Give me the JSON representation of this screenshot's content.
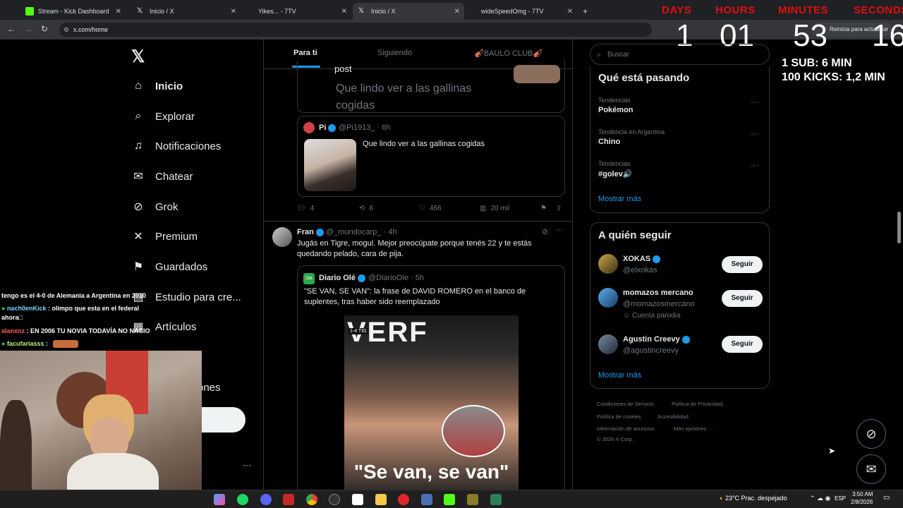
{
  "tabs": [
    {
      "title": "Stream - Kick Dashboard",
      "color": "#53fc18"
    },
    {
      "title": "Inicio / X",
      "color": "#000000"
    },
    {
      "title": "Yikes... - 7TV",
      "color": "#29b6f6"
    },
    {
      "title": "Inicio / X",
      "color": "#000000"
    },
    {
      "title": "wideSpeedOmg - 7TV",
      "color": "#29b6f6"
    }
  ],
  "browser": {
    "url": "x.com/home",
    "restart_label": "Reinicia para actualizar"
  },
  "countdown": {
    "labels": [
      "DAYS",
      "HOURS",
      "MINUTES",
      "SECONDS"
    ],
    "values": [
      "1",
      "01",
      "53",
      "16"
    ]
  },
  "subathon": {
    "line1": "1 SUB: 6 MIN",
    "line2": "100 KICKS: 1,2 MIN"
  },
  "nav": [
    {
      "label": "Inicio",
      "icon": "home-icon"
    },
    {
      "label": "Explorar",
      "icon": "search-icon"
    },
    {
      "label": "Notificaciones",
      "icon": "bell-icon"
    },
    {
      "label": "Chatear",
      "icon": "mail-icon"
    },
    {
      "label": "Grok",
      "icon": "grok-icon"
    },
    {
      "label": "Premium",
      "icon": "x-logo-icon"
    },
    {
      "label": "Guardados",
      "icon": "bookmark-icon"
    },
    {
      "label": "Estudio para cre...",
      "icon": "studio-icon"
    },
    {
      "label": "Artículos",
      "icon": "article-icon"
    },
    {
      "label": "ones",
      "icon": ""
    }
  ],
  "feed_tabs": [
    "Para ti",
    "Siguiendo",
    "🎻BAULO CLUB🎻"
  ],
  "post1": {
    "quoted_tail": "post",
    "quoted_text": "Que lindo ver a las gallinas cogidas",
    "inner_name": "Pi",
    "inner_handle": "@Pi1913_ · 6h",
    "inner_text": "Que lindo ver a las gallinas cogidas",
    "replies": "4",
    "reposts": "6",
    "likes": "466",
    "views": "20 mil"
  },
  "post2": {
    "name": "Fran",
    "handle": "@_mundocarp_ · 4h",
    "text": "Jugás en Tigre, mogul. Mejor preocúpate porque tenés 22 y te estás quedando pelado, cara de pija.",
    "quoted_name": "Diario Olé",
    "quoted_handle": "@DiarioOle · 5h",
    "quoted_text": "\"SE VAN, SE VAN\": la frase de DAVID ROMERO en el banco de suplentes, tras haber sido reemplazado",
    "image_caption": "\"Se van, se van\"",
    "image_score": "1-4  TIG"
  },
  "search_placeholder": "Buscar",
  "trends": {
    "title": "Qué está pasando",
    "items": [
      {
        "category": "Tendencias",
        "name": "Pokémon"
      },
      {
        "category": "Tendencia en Argentina",
        "name": "Chino"
      },
      {
        "category": "Tendencias",
        "name": "#golev🔊"
      }
    ],
    "more": "Mostrar más"
  },
  "follow": {
    "title": "A quién seguir",
    "items": [
      {
        "name": "XOKAS",
        "handle": "@elxokas",
        "extra": ""
      },
      {
        "name": "momazos mercano",
        "handle": "@momazosmercano",
        "extra": "Cuenta parodia"
      },
      {
        "name": "Agustin Creevy",
        "handle": "@agustincreevy",
        "extra": ""
      }
    ],
    "button": "Seguir",
    "more": "Mostrar más"
  },
  "footer": {
    "l1": "Condiciones de Servicio",
    "l2": "Política de Privacidad",
    "l3": "Política de cookies",
    "l4": "Accesibilidad",
    "l5": "Información de anuncios",
    "l6": "Más opciones ···",
    "l7": "© 2026 X Corp."
  },
  "chat": [
    {
      "user": "",
      "text": "tengo es el 4-0 de Alemania a Argentina en 2010",
      "color": "#ffffff"
    },
    {
      "user": "nach0enKick",
      "text": ": olimpo que esta en el federal ahora□",
      "color": "#7fd3ff"
    },
    {
      "user": "alanxnz",
      "text": ": EN 2006 TU NOVIA TODAVÍA NO NACIO",
      "color": "#ff5a5a"
    },
    {
      "user": "facufariasss",
      "text": ":",
      "color": "#b5f27a"
    }
  ],
  "taskbar": {
    "weather": "23°C  Prac. despejado",
    "lang": "ESP",
    "time": "3:50 AM",
    "date": "2/8/2026"
  }
}
